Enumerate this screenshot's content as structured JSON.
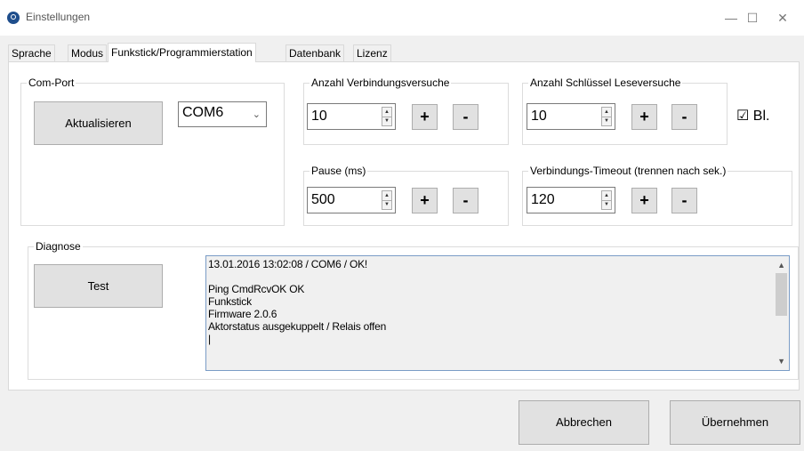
{
  "window": {
    "title": "Einstellungen",
    "minimize": "—",
    "maximize": "☐",
    "close": "✕"
  },
  "tabs": [
    {
      "label": "Sprache"
    },
    {
      "label": "Modus"
    },
    {
      "label": "Funkstick/Programmierstation",
      "active": true
    },
    {
      "label": "Datenbank"
    },
    {
      "label": "Lizenz"
    }
  ],
  "comport": {
    "legend": "Com-Port",
    "refresh_label": "Aktualisieren",
    "selected": "COM6"
  },
  "conn_attempts": {
    "legend": "Anzahl Verbindungsversuche",
    "value": "10"
  },
  "key_attempts": {
    "legend": "Anzahl Schlüssel Leseversuche",
    "value": "10"
  },
  "pause": {
    "legend": "Pause (ms)",
    "value": "500"
  },
  "timeout": {
    "legend": "Verbindungs-Timeout (trennen nach sek.)",
    "value": "120"
  },
  "plus_label": "+",
  "minus_label": "-",
  "bl_checkbox": {
    "label": "Bl.",
    "checked": true
  },
  "diagnose": {
    "legend": "Diagnose",
    "test_label": "Test",
    "log_lines": [
      "13.01.2016 13:02:08 / COM6 / OK!",
      "",
      "Ping CmdRcvOK OK",
      "Funkstick",
      "Firmware 2.0.6",
      "Aktorstatus ausgekuppelt / Relais offen",
      "|"
    ]
  },
  "footer": {
    "cancel_label": "Abbrechen",
    "apply_label": "Übernehmen"
  },
  "colors": {
    "window_bg": "#f0f0f0",
    "panel_bg": "#ffffff",
    "button_bg": "#e1e1e1",
    "focus_border": "#7a9cc6",
    "icon_blue": "#1f4e8c"
  }
}
